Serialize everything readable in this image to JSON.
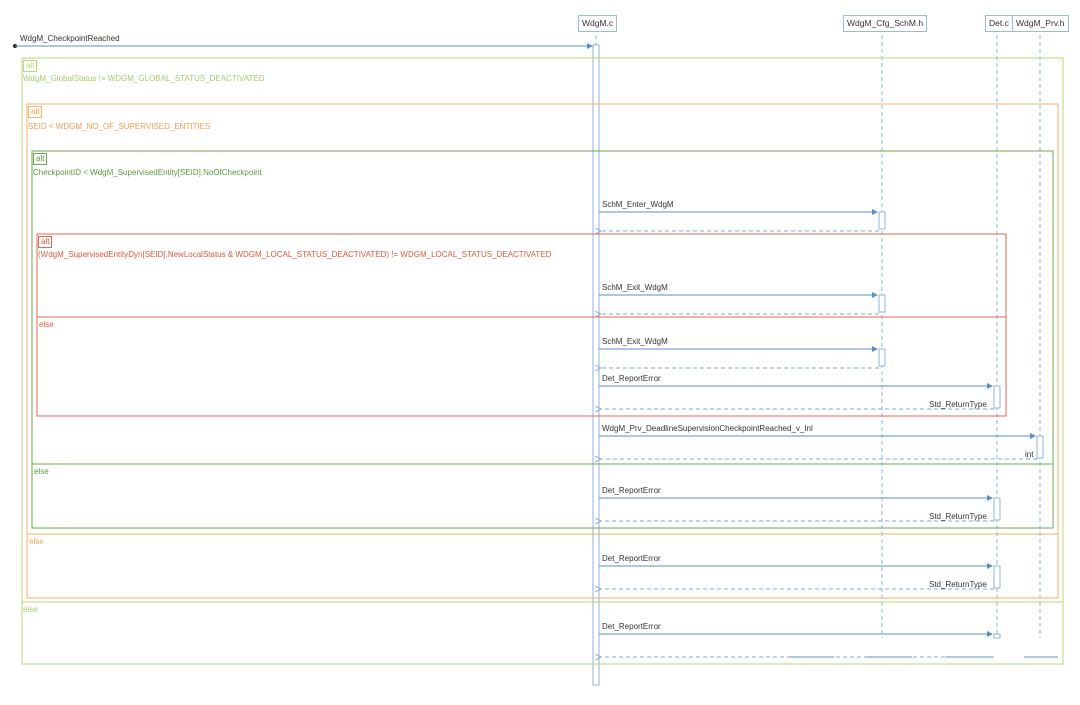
{
  "lifelines": {
    "wdgm_c": "WdgM.c",
    "cfg_schm": "WdgM_Cfg_SchM.h",
    "det_c": "Det.c",
    "prv_h": "WdgM_Prv.h"
  },
  "entry_call": "WdgM_CheckpointReached",
  "frames": {
    "f1": {
      "tag": "alt",
      "cond": "WdgM_GlobalStatus != WDGM_GLOBAL_STATUS_DEACTIVATED",
      "else": "else",
      "color": "#b6d97a"
    },
    "f2": {
      "tag": "alt",
      "cond": "SEID < WDGM_NO_OF_SUPERVISED_ENTITIES",
      "else": "else",
      "color": "#f5b26b"
    },
    "f3": {
      "tag": "alt",
      "cond": "CheckpointID < WdgM_SupervisedEntity[SEID].NoOfCheckpoint",
      "else": "else",
      "color": "#6aaa4e"
    },
    "f4": {
      "tag": "alt",
      "cond": "(WdgM_SupervisedEntityDyn[SEID].NewLocalStatus & WDGM_LOCAL_STATUS_DEACTIVATED) != WDGM_LOCAL_STATUS_DEACTIVATED",
      "else": "else",
      "color": "#e06a50"
    }
  },
  "messages": {
    "m1": "SchM_Enter_WdgM",
    "m2": "SchM_Exit_WdgM",
    "m3": "SchM_Exit_WdgM",
    "m4": "Det_ReportError",
    "r4": "Std_ReturnType",
    "m5": "WdgM_Prv_DeadlineSupervisionCheckpointReached_v_Inl",
    "r5": "int",
    "m6": "Det_ReportError",
    "r6": "Std_ReturnType",
    "m7": "Det_ReportError",
    "r7": "Std_ReturnType",
    "m8": "Det_ReportError"
  },
  "colors": {
    "lifeline": "#8fb6d8",
    "arrow": "#5b8fc2",
    "return": "#7fa8cf"
  }
}
